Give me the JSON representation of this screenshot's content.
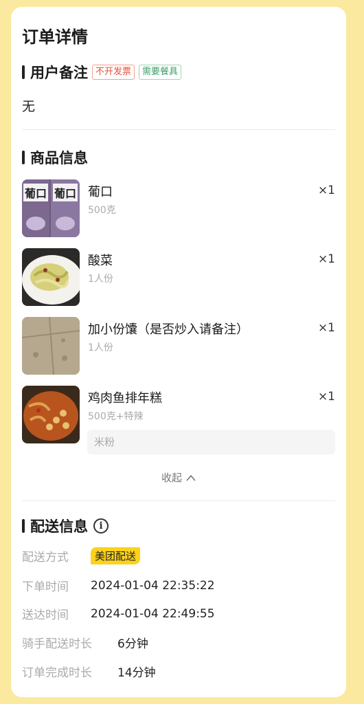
{
  "page": {
    "title": "订单详情"
  },
  "remark": {
    "title": "用户备注",
    "tags": [
      "不开发票",
      "需要餐具"
    ],
    "text": "无"
  },
  "products": {
    "title": "商品信息",
    "items": [
      {
        "name": "葡口",
        "spec": "500克",
        "qty": "×1"
      },
      {
        "name": "酸菜",
        "spec": "1人份",
        "qty": "×1"
      },
      {
        "name": "加小份馕（是否炒入请备注）",
        "spec": "1人份",
        "qty": "×1"
      },
      {
        "name": "鸡肉鱼排年糕",
        "spec": "500克+特辣",
        "qty": "×1",
        "note": "米粉"
      }
    ],
    "collapse_label": "收起"
  },
  "delivery": {
    "title": "配送信息",
    "rows": [
      {
        "label": "配送方式",
        "value": "美团配送"
      },
      {
        "label": "下单时间",
        "value": "2024-01-04 22:35:22"
      },
      {
        "label": "送达时间",
        "value": "2024-01-04 22:49:55"
      },
      {
        "label": "骑手配送时长",
        "value": "6分钟"
      },
      {
        "label": "订单完成时长",
        "value": "14分钟"
      }
    ]
  },
  "colors": {
    "background": "#fbe9a0",
    "accent_yellow": "#fcd21c",
    "tag_red": "#e0533b",
    "tag_green": "#3c9d6a"
  },
  "icons": {
    "info": "info-circle-icon",
    "collapse": "chevron-up-icon"
  }
}
